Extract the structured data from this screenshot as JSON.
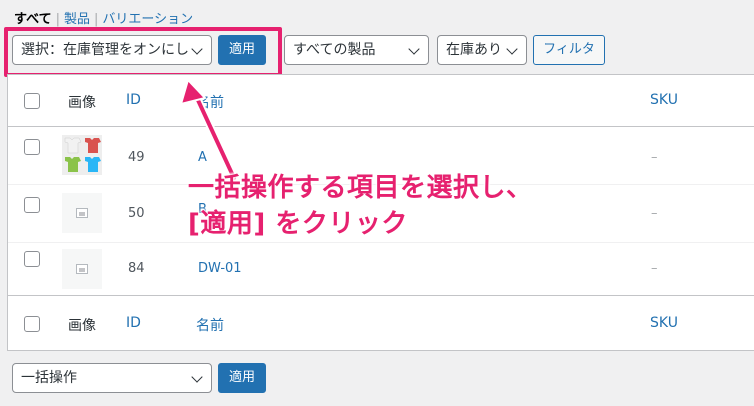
{
  "views": {
    "all": "すべて",
    "sep1": "|",
    "products": "製品",
    "sep2": "|",
    "variations": "バリエーション"
  },
  "top_bulk": {
    "selected": "選択：在庫管理をオンにし",
    "apply": "適用"
  },
  "filters": {
    "product_type": "すべての製品",
    "stock_status": "在庫あり",
    "filter_button": "フィルタ"
  },
  "columns": {
    "image": "画像",
    "id": "ID",
    "name": "名前",
    "sku": "SKU"
  },
  "rows": [
    {
      "id": "49",
      "name": "A",
      "sku": "–",
      "thumb": "tshirt-grid-image"
    },
    {
      "id": "50",
      "name": "B",
      "sku": "–",
      "thumb": "placeholder-image"
    },
    {
      "id": "84",
      "name": "DW-01",
      "sku": "–",
      "thumb": "placeholder-image"
    }
  ],
  "bottom_bulk": {
    "selected": "一括操作",
    "apply": "適用"
  },
  "annotation": {
    "line1": "一括操作する項目を選択し、",
    "line2": "[適用] をクリック",
    "color": "#e6216f"
  },
  "colors": {
    "accent": "#2271b1",
    "highlight": "#e6216f"
  }
}
